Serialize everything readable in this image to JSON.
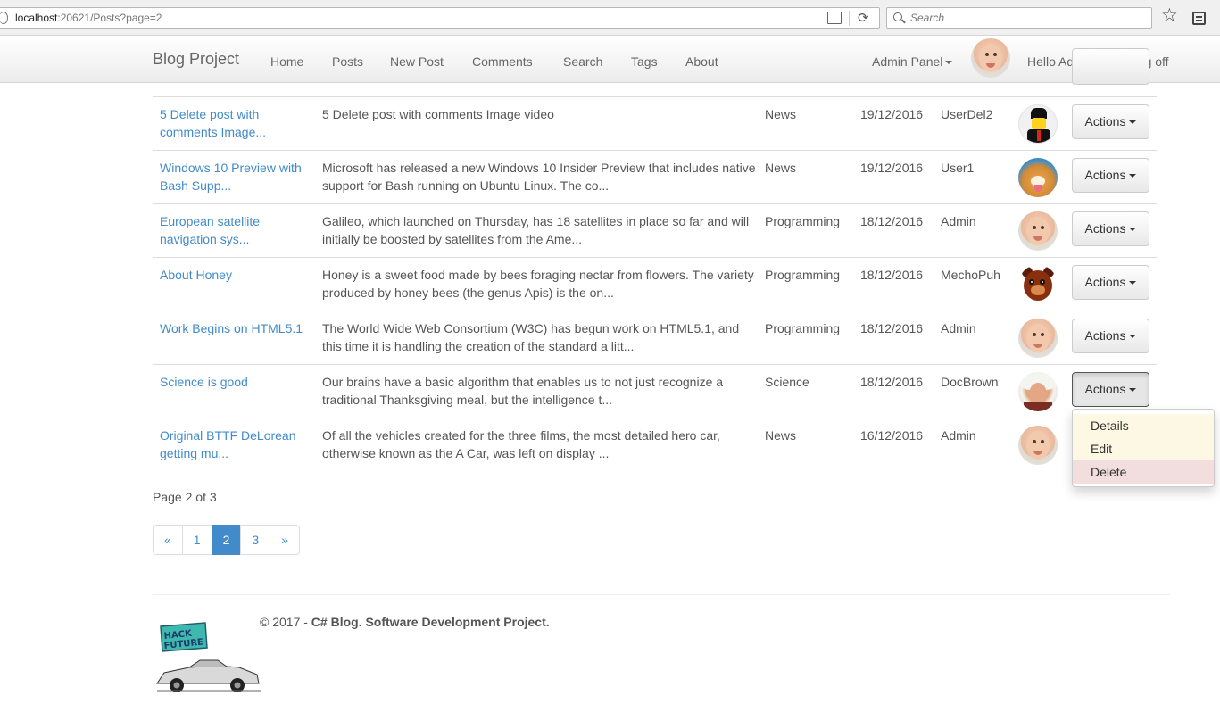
{
  "browser": {
    "url_host": "localhost",
    "url_rest": ":20621/Posts?page=2",
    "search_placeholder": "Search"
  },
  "navbar": {
    "brand": "Blog Project",
    "links": [
      "Home",
      "Posts",
      "New Post",
      "Comments",
      "Search",
      "Tags",
      "About"
    ],
    "admin_panel": "Admin Panel",
    "greeting": "Hello Admin!",
    "logoff": "Log off"
  },
  "posts": [
    {
      "title": "5 Delete post with comments Image...",
      "body": "5 Delete post with comments Image video",
      "category": "News",
      "date": "19/12/2016",
      "user": "UserDel2",
      "avatar": "lego-icon",
      "action": "Actions"
    },
    {
      "title": "Windows 10 Preview with Bash Supp...",
      "body": "Microsoft has released a new Windows 10 Insider Preview that includes native support for Bash running on Ubuntu Linux. The co...",
      "category": "News",
      "date": "19/12/2016",
      "user": "User1",
      "avatar": "dog-icon",
      "action": "Actions"
    },
    {
      "title": "European satellite navigation sys...",
      "body": "Galileo, which launched on Thursday, has 18 satellites in place so far and will initially be boosted by satellites from the Ame...",
      "category": "Programming",
      "date": "18/12/2016",
      "user": "Admin",
      "avatar": "baby-icon",
      "action": "Actions"
    },
    {
      "title": "About Honey",
      "body": "Honey is a sweet food made by bees foraging nectar from flowers. The variety produced by honey bees (the genus Apis) is the on...",
      "category": "Programming",
      "date": "18/12/2016",
      "user": "MechoPuh",
      "avatar": "bear-icon",
      "action": "Actions"
    },
    {
      "title": "Work Begins on HTML5.1",
      "body": "The World Wide Web Consortium (W3C) has begun work on HTML5.1, and this time it is handling the creation of the standard a litt...",
      "category": "Programming",
      "date": "18/12/2016",
      "user": "Admin",
      "avatar": "baby-icon",
      "action": "Actions"
    },
    {
      "title": "Science is good",
      "body": "Our brains have a basic algorithm that enables us to not just recognize a traditional Thanksgiving meal, but the intelligence t...",
      "category": "Science",
      "date": "18/12/2016",
      "user": "DocBrown",
      "avatar": "doc-icon",
      "action": "Actions"
    },
    {
      "title": "Original BTTF DeLorean getting mu...",
      "body": "Of all the vehicles created for the three films, the most detailed hero car, otherwise known as the A Car, was left on display ...",
      "category": "News",
      "date": "16/12/2016",
      "user": "Admin",
      "avatar": "baby-icon",
      "action": ""
    }
  ],
  "dropdown": {
    "items": [
      "Details",
      "Edit",
      "Delete"
    ]
  },
  "pagination": {
    "info": "Page 2 of 3",
    "prev": "«",
    "pages": [
      "1",
      "2",
      "3"
    ],
    "next": "»",
    "current": "2"
  },
  "footer": {
    "prefix": "© 2017 - ",
    "bold": "C# Blog. Software Development Project."
  },
  "colors": {
    "link": "#428bca",
    "warning": "#fcf8e3",
    "danger": "#f2dede"
  }
}
